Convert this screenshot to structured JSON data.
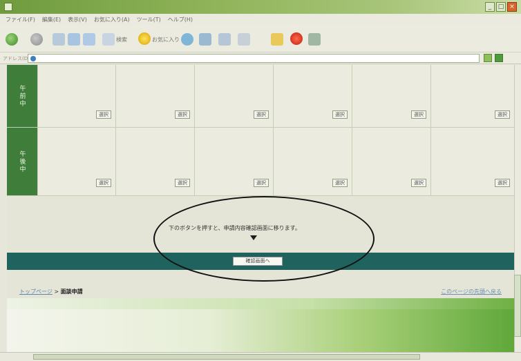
{
  "window": {
    "title": "",
    "controls": [
      "_",
      "□",
      "×"
    ]
  },
  "menubar": {
    "items": [
      "ファイル(F)",
      "編集(E)",
      "表示(V)",
      "お気に入り(A)",
      "ツール(T)",
      "ヘルプ(H)"
    ]
  },
  "toolbar": {
    "search_label": "検索",
    "favorites_label": "お気に入り"
  },
  "address": {
    "label": "アドレス(D)",
    "url": ""
  },
  "schedule": {
    "rows": [
      {
        "label": "午前中",
        "cells": [
          "選択",
          "選択",
          "選択",
          "選択",
          "選択",
          "選択"
        ]
      },
      {
        "label": "午後中",
        "cells": [
          "選択",
          "選択",
          "選択",
          "選択",
          "選択",
          "選択"
        ]
      }
    ]
  },
  "notice": {
    "text": "下のボタンを押すと、申請内容確認画面に移ります。"
  },
  "confirm": {
    "button_label": "確認画面へ"
  },
  "breadcrumb": {
    "link": "トップページ",
    "separator": " > ",
    "current": "面談申請"
  },
  "footer": {
    "right_link": "このページの先頭へ戻る",
    "copyright": ""
  },
  "colors": {
    "row_label": "#3e7d3a",
    "confirm_bar": "#20635e",
    "titlebar": "#8fb358"
  }
}
